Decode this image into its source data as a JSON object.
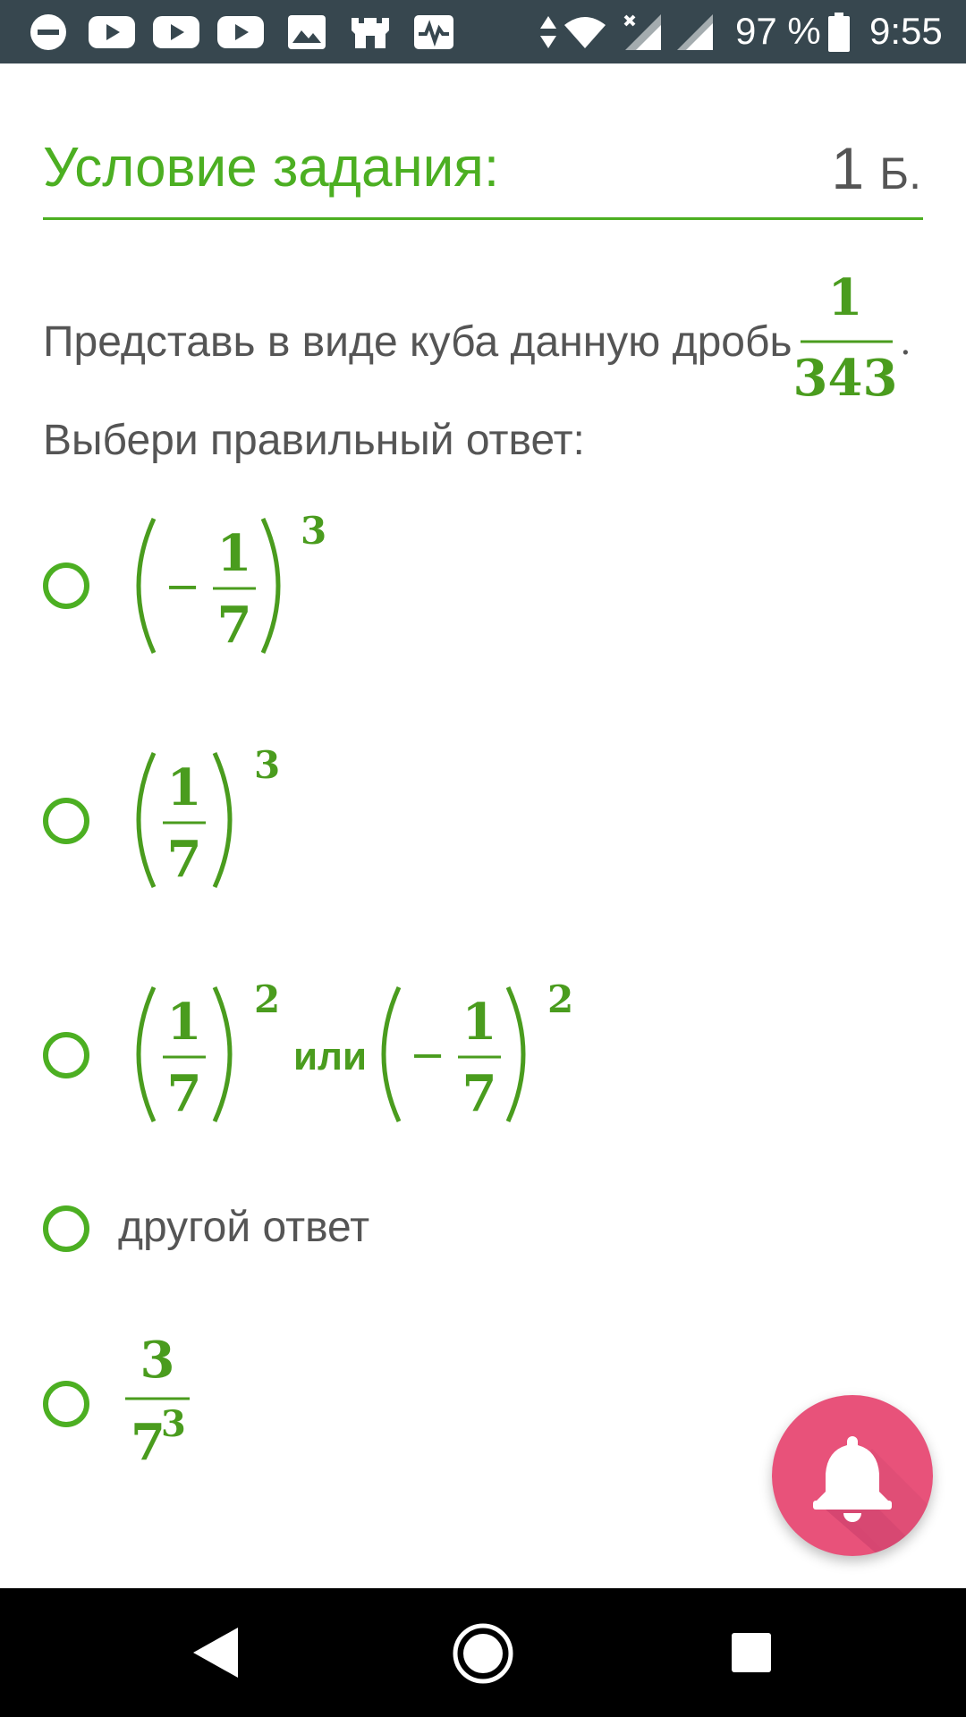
{
  "status_bar": {
    "battery_percent": "97 %",
    "time": "9:55",
    "left_icons": [
      "minus-circle-icon",
      "youtube-icon",
      "youtube-icon",
      "youtube-icon",
      "image-icon",
      "castle-icon",
      "activity-icon"
    ],
    "right_icons": [
      "data-arrows-icon",
      "wifi-icon",
      "signal-no-service-icon",
      "signal-icon",
      "battery-icon"
    ]
  },
  "task": {
    "title": "Условие задания:",
    "points_value": "1",
    "points_unit": "Б."
  },
  "question": {
    "text": "Представь в виде куба данную дробь",
    "fraction_numerator": "1",
    "fraction_denominator": "343",
    "trailing": ".",
    "instruction": "Выбери правильный ответ:"
  },
  "options": [
    {
      "sign": "−",
      "numerator": "1",
      "denominator": "7",
      "exponent": "3"
    },
    {
      "numerator": "1",
      "denominator": "7",
      "exponent": "3"
    },
    {
      "left": {
        "numerator": "1",
        "denominator": "7",
        "exponent": "2"
      },
      "joiner": "или",
      "right": {
        "sign": "−",
        "numerator": "1",
        "denominator": "7",
        "exponent": "2"
      }
    },
    {
      "text": "другой ответ"
    },
    {
      "numerator": "3",
      "denominator_base": "7",
      "denominator_exponent": "3"
    }
  ],
  "fab": {
    "icon": "bell-icon"
  },
  "nav_bar": {
    "icons": [
      "back-icon",
      "home-icon",
      "recents-icon"
    ]
  },
  "colors": {
    "accent_green": "#4caf22",
    "math_green": "#4a9c1e",
    "status_bar_bg": "#37474f",
    "fab_pink": "#e8527a",
    "text_gray": "#555555"
  }
}
